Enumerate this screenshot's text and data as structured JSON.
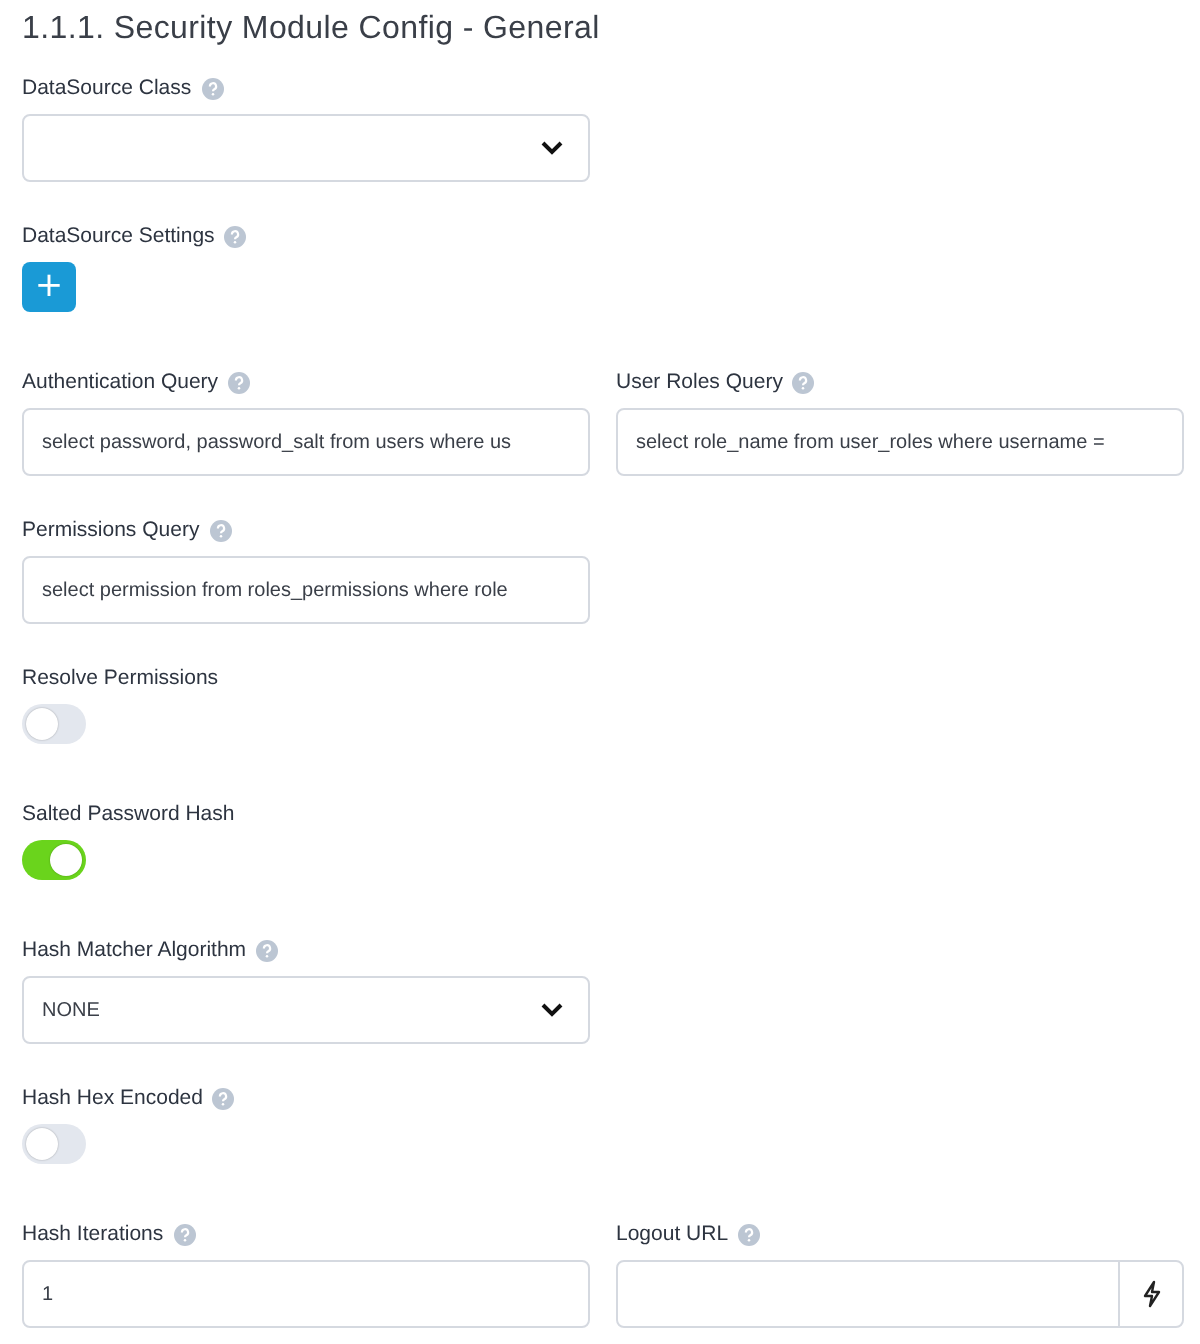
{
  "title": "1.1.1. Security Module Config - General",
  "rows": [
    {
      "fields": [
        {
          "kind": "select",
          "label": "DataSource Class",
          "help": true
        }
      ]
    },
    {
      "fields": [
        {
          "kind": "add",
          "label": "DataSource Settings",
          "help": true,
          "button": "+"
        }
      ]
    },
    {
      "fields": [
        {
          "kind": "text",
          "label": "Authentication Query",
          "help": true,
          "value": "select password, password_salt from users where us"
        },
        {
          "kind": "text",
          "label": "User Roles Query",
          "help": true,
          "value": "select role_name from user_roles where username ="
        }
      ]
    },
    {
      "fields": [
        {
          "kind": "text",
          "label": "Permissions Query",
          "help": true,
          "value": "select permission from roles_permissions where role"
        }
      ]
    },
    {
      "fields": [
        {
          "kind": "toggle",
          "label": "Resolve Permissions",
          "help": false,
          "on": false
        }
      ]
    },
    {
      "fields": [
        {
          "kind": "toggle",
          "label": "Salted Password Hash",
          "help": false,
          "on": true
        }
      ]
    },
    {
      "fields": [
        {
          "kind": "select",
          "label": "Hash Matcher Algorithm",
          "help": true,
          "value": "NONE"
        }
      ]
    },
    {
      "fields": [
        {
          "kind": "toggle",
          "label": "Hash Hex Encoded",
          "help": true,
          "on": false
        }
      ]
    },
    {
      "fields": [
        {
          "kind": "text",
          "label": "Hash Iterations",
          "help": true,
          "value": "1"
        },
        {
          "kind": "action",
          "label": "Logout URL",
          "help": true
        }
      ]
    }
  ]
}
